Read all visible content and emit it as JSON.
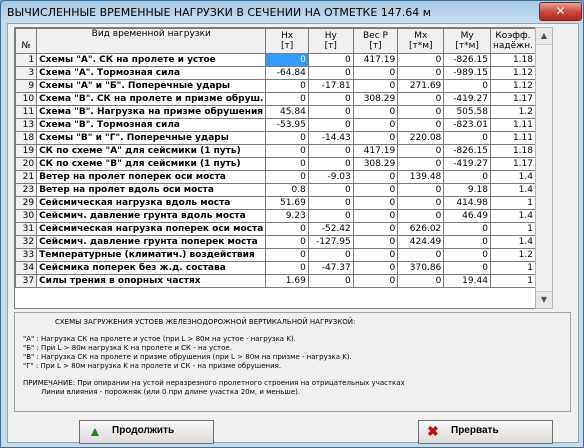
{
  "window": {
    "title": "ВЫЧИСЛЕННЫЕ ВРЕМЕННЫЕ НАГРУЗКИ В СЕЧЕНИИ НА ОТМЕТКЕ  147.64 м",
    "close_glyph": "✕"
  },
  "table": {
    "headers": {
      "n": "№",
      "name": "Вид временной нагрузки",
      "hx": "Hx",
      "hx_unit": "[т]",
      "hy": "Hy",
      "hy_unit": "[т]",
      "p": "Вес  P",
      "p_unit": "[т]",
      "mx": "Mx",
      "mx_unit": "[т*м]",
      "my": "My",
      "my_unit": "[т*м]",
      "k": "Коэфф.",
      "k2": "надёжн."
    },
    "rows": [
      {
        "n": "1",
        "name": "Схемы \"А\".  СК на пролете и устое",
        "hx": "0",
        "hy": "0",
        "p": "417.19",
        "mx": "0",
        "my": "-826.15",
        "k": "1.18"
      },
      {
        "n": "3",
        "name": "Схема \"А\".  Тормозная сила",
        "hx": "-64.84",
        "hy": "0",
        "p": "0",
        "mx": "0",
        "my": "-989.15",
        "k": "1.12"
      },
      {
        "n": "9",
        "name": "Схемы \"А\" и \"Б\". Поперечные удары",
        "hx": "0",
        "hy": "-17.81",
        "p": "0",
        "mx": "271.69",
        "my": "0",
        "k": "1.12"
      },
      {
        "n": "10",
        "name": "Схема \"В\".  СК на пролете и призме обруш.",
        "hx": "0",
        "hy": "0",
        "p": "308.29",
        "mx": "0",
        "my": "-419.27",
        "k": "1.17"
      },
      {
        "n": "11",
        "name": "Схема \"В\". Нагрузка на призме обрушения",
        "hx": "45.84",
        "hy": "0",
        "p": "0",
        "mx": "0",
        "my": "505.58",
        "k": "1.2"
      },
      {
        "n": "13",
        "name": "Схема \"В\".  Тормозная сила",
        "hx": "-53.95",
        "hy": "0",
        "p": "0",
        "mx": "0",
        "my": "-823.01",
        "k": "1.11"
      },
      {
        "n": "18",
        "name": "Схемы \"В\" и \"Г\". Поперечные удары",
        "hx": "0",
        "hy": "-14.43",
        "p": "0",
        "mx": "220.08",
        "my": "0",
        "k": "1.11"
      },
      {
        "n": "19",
        "name": "СК по схеме \"А\" для сейсмики (1 путь)",
        "hx": "0",
        "hy": "0",
        "p": "417.19",
        "mx": "0",
        "my": "-826.15",
        "k": "1.18"
      },
      {
        "n": "20",
        "name": "СК по схеме \"В\" для сейсмики (1 путь)",
        "hx": "0",
        "hy": "0",
        "p": "308.29",
        "mx": "0",
        "my": "-419.27",
        "k": "1.17"
      },
      {
        "n": "21",
        "name": "Ветер на пролет поперек оси моста",
        "hx": "0",
        "hy": "-9.03",
        "p": "0",
        "mx": "139.48",
        "my": "0",
        "k": "1.4"
      },
      {
        "n": "23",
        "name": "Ветер на пролет вдоль оси моста",
        "hx": "0.8",
        "hy": "0",
        "p": "0",
        "mx": "0",
        "my": "9.18",
        "k": "1.4"
      },
      {
        "n": "29",
        "name": "Сейсмическая нагрузка вдоль моста",
        "hx": "51.69",
        "hy": "0",
        "p": "0",
        "mx": "0",
        "my": "414.98",
        "k": "1"
      },
      {
        "n": "30",
        "name": "Сейсмич. давление грунта вдоль моста",
        "hx": "9.23",
        "hy": "0",
        "p": "0",
        "mx": "0",
        "my": "46.49",
        "k": "1.4"
      },
      {
        "n": "31",
        "name": "Сейсмическая нагрузка поперек оси моста",
        "hx": "0",
        "hy": "-52.42",
        "p": "0",
        "mx": "626.02",
        "my": "0",
        "k": "1"
      },
      {
        "n": "32",
        "name": "Сейсмич. давление грунта поперек моста",
        "hx": "0",
        "hy": "-127.95",
        "p": "0",
        "mx": "424.49",
        "my": "0",
        "k": "1.4"
      },
      {
        "n": "33",
        "name": "Температурные (климатич.) воздействия",
        "hx": "0",
        "hy": "0",
        "p": "0",
        "mx": "0",
        "my": "0",
        "k": "1.2"
      },
      {
        "n": "34",
        "name": "Сейсмика поперек без ж.д. состава",
        "hx": "0",
        "hy": "-47.37",
        "p": "0",
        "mx": "370.86",
        "my": "0",
        "k": "1"
      },
      {
        "n": "37",
        "name": "Силы трения в опорных частях",
        "hx": "1.69",
        "hy": "0",
        "p": "0",
        "mx": "0",
        "my": "19.44",
        "k": "1"
      }
    ]
  },
  "notes": {
    "heading": "СХЕМЫ ЗАГРУЖЕНИЯ УСТОЕВ ЖЕЛЕЗНОДОРОЖНОЙ ВЕРТИКАЛЬНОЙ НАГРУЗКОЙ:",
    "a": "\"А\"  : Нагрузка СК на пролете и устое (при L > 80м на устое - нагрузка K).",
    "b": "\"Б\"  : При L > 80м нагрузка K на пролете и СК - на устое.",
    "v": "\"В\"  : Нагрузка СК на пролете и призме обрушения (при L > 80м на призме - нагрузка K).",
    "g": "\"Г\"  : При L > 80м нагрузка K на пролете и СК - на призме обрушения.",
    "remark1": "ПРИМЕЧАНИЕ: При опирании на устой неразрезного пролетного строения на отрицательных участках",
    "remark2": "Линии влияния - порожняк (или 0 при длине участка 20м, и меньше)."
  },
  "buttons": {
    "continue": "Продолжить",
    "abort": "Прервать"
  },
  "scrollbar": {
    "up": "▲",
    "down": "▼"
  },
  "colors": {
    "selection": "#3399ff",
    "continue_icon": "#1a8a1a",
    "abort_icon": "#c01010"
  }
}
